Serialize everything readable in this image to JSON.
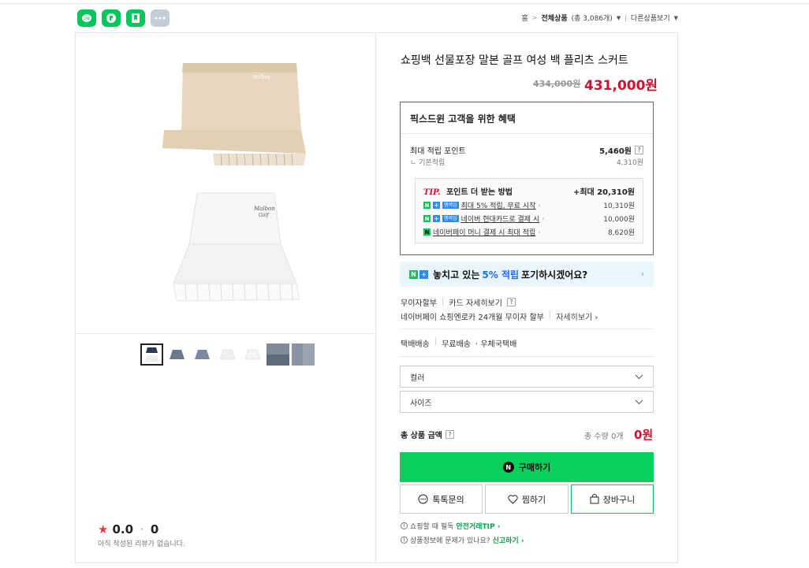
{
  "share": {
    "icons": [
      "line-share-icon",
      "kakaostory-share-icon",
      "bookmark-icon",
      "more-icon"
    ]
  },
  "breadcrumb": {
    "home": "홈",
    "all": "전체상품",
    "count": "(총 3,086개)",
    "other": "다른상품보기"
  },
  "product": {
    "title": "쇼핑백 선물포장 말본 골프 여성 백 플리츠 스커트",
    "original_price": "434,000원",
    "sale_price": "431,000원"
  },
  "rating": {
    "score": "0.0",
    "count": "0",
    "note": "아직 작성된 리뷰가 없습니다."
  },
  "benefits": {
    "heading": "픽스드윈 고객을 위한 혜택",
    "max_points_label": "최대 적립 포인트",
    "max_points_value": "5,460원",
    "base_label": "기본적립",
    "base_value": "4,310원",
    "tip": {
      "tip_mark": "TIP.",
      "title": "포인트 더 받는 방법",
      "max": "+최대 20,310원",
      "badge_label": "멤버십",
      "rows": [
        {
          "label": "최대 5% 적립, 무료 시작",
          "value": "10,310원"
        },
        {
          "label": "네이버 현대카드로 결제 시",
          "value": "10,000원"
        },
        {
          "label": "네이버페이 머니 결제 시 최대 적립",
          "value": "8,620원"
        }
      ]
    }
  },
  "promo": {
    "text_before": "놓치고 있는",
    "highlight": "5% 적립",
    "text_after": "포기하시겠어요?"
  },
  "payment": {
    "installment": "무이자할부",
    "card_detail": "카드 자세히보기",
    "npay_text": "네이버페이 쇼핑엔로카 24개월 무이자 할부",
    "npay_link": "자세히보기"
  },
  "shipping": {
    "type": "택배배송",
    "fee": "무료배송",
    "carrier": "· 우체국택배"
  },
  "options": {
    "color_placeholder": "컬러",
    "size_placeholder": "사이즈"
  },
  "total": {
    "label": "총 상품 금액",
    "qty": "총 수량 0개",
    "price": "0원"
  },
  "buttons": {
    "buy": "구매하기",
    "talk": "톡톡문의",
    "wish": "찜하기",
    "cart": "장바구니"
  },
  "notes": {
    "safe_text": "쇼핑할 때 필독",
    "safe_link": "안전거래TIP",
    "report_text": "상품정보에 문제가 있나요?",
    "report_link": "신고하기"
  },
  "colors": {
    "brand_green": "#03c75a",
    "sale_red": "#d1102e",
    "promo_blue": "#1a6ff0"
  }
}
